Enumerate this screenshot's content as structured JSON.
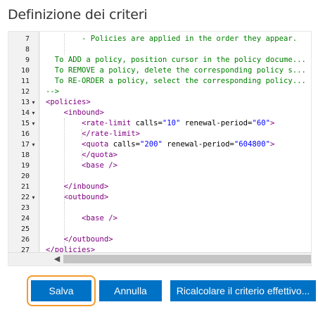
{
  "page": {
    "title": "Definizione dei criteri"
  },
  "editor": {
    "lines": [
      {
        "n": "7",
        "fold": "",
        "segs": [
          {
            "t": "    - Policies are applied in the order they appear.",
            "c": "comment"
          }
        ],
        "indent": 4
      },
      {
        "n": "8",
        "fold": "",
        "segs": [],
        "indent": 0
      },
      {
        "n": "9",
        "fold": "",
        "segs": [
          {
            "t": "  To ADD a policy, position cursor in the policy docume...",
            "c": "comment"
          }
        ],
        "indent": 0
      },
      {
        "n": "10",
        "fold": "",
        "segs": [
          {
            "t": "  To REMOVE a policy, delete the corresponding policy s...",
            "c": "comment"
          }
        ],
        "indent": 0
      },
      {
        "n": "11",
        "fold": "",
        "segs": [
          {
            "t": "  To RE-ORDER a policy, select the corresponding policy...",
            "c": "comment"
          }
        ],
        "indent": 0
      },
      {
        "n": "12",
        "fold": "",
        "segs": [
          {
            "t": "-->",
            "c": "comment"
          }
        ],
        "indent": 0
      },
      {
        "n": "13",
        "fold": "▾",
        "segs": [
          {
            "t": "<policies>",
            "c": "tag"
          }
        ],
        "indent": 0
      },
      {
        "n": "14",
        "fold": "▾",
        "segs": [
          {
            "t": "    ",
            "c": "text"
          },
          {
            "t": "<inbound>",
            "c": "tag"
          }
        ],
        "indent": 0
      },
      {
        "n": "15",
        "fold": "▾",
        "segs": [
          {
            "t": "        ",
            "c": "text"
          },
          {
            "t": "<rate-limit",
            "c": "tag"
          },
          {
            "t": " calls=",
            "c": "attr"
          },
          {
            "t": "\"10\"",
            "c": "val"
          },
          {
            "t": " renewal-period=",
            "c": "attr"
          },
          {
            "t": "\"60\"",
            "c": "val"
          },
          {
            "t": ">",
            "c": "tag"
          }
        ],
        "indent": 0
      },
      {
        "n": "16",
        "fold": "",
        "segs": [
          {
            "t": "        ",
            "c": "text"
          },
          {
            "t": "</rate-limit>",
            "c": "tag"
          }
        ],
        "indent": 0
      },
      {
        "n": "17",
        "fold": "▾",
        "segs": [
          {
            "t": "        ",
            "c": "text"
          },
          {
            "t": "<quota",
            "c": "tag"
          },
          {
            "t": " calls=",
            "c": "attr"
          },
          {
            "t": "\"200\"",
            "c": "val"
          },
          {
            "t": " renewal-period=",
            "c": "attr"
          },
          {
            "t": "\"604800\"",
            "c": "val"
          },
          {
            "t": ">",
            "c": "tag"
          }
        ],
        "indent": 0
      },
      {
        "n": "18",
        "fold": "",
        "segs": [
          {
            "t": "        ",
            "c": "text"
          },
          {
            "t": "</quota>",
            "c": "tag"
          }
        ],
        "indent": 0
      },
      {
        "n": "19",
        "fold": "",
        "segs": [
          {
            "t": "        ",
            "c": "text"
          },
          {
            "t": "<base />",
            "c": "tag"
          }
        ],
        "indent": 0
      },
      {
        "n": "20",
        "fold": "",
        "segs": [],
        "indent": 0
      },
      {
        "n": "21",
        "fold": "",
        "segs": [
          {
            "t": "    ",
            "c": "text"
          },
          {
            "t": "</inbound>",
            "c": "tag"
          }
        ],
        "indent": 0
      },
      {
        "n": "22",
        "fold": "▾",
        "segs": [
          {
            "t": "    ",
            "c": "text"
          },
          {
            "t": "<outbound>",
            "c": "tag"
          }
        ],
        "indent": 0
      },
      {
        "n": "23",
        "fold": "",
        "segs": [],
        "indent": 0
      },
      {
        "n": "24",
        "fold": "",
        "segs": [
          {
            "t": "        ",
            "c": "text"
          },
          {
            "t": "<base />",
            "c": "tag"
          }
        ],
        "indent": 0
      },
      {
        "n": "25",
        "fold": "",
        "segs": [],
        "indent": 0
      },
      {
        "n": "26",
        "fold": "",
        "segs": [
          {
            "t": "    ",
            "c": "text"
          },
          {
            "t": "</outbound>",
            "c": "tag"
          }
        ],
        "indent": 0
      },
      {
        "n": "27",
        "fold": "",
        "segs": [
          {
            "t": "</policies>",
            "c": "tag"
          }
        ],
        "indent": 0
      }
    ]
  },
  "buttons": {
    "save": "Salva",
    "cancel": "Annulla",
    "recalculate": "Ricalcolare il criterio effettivo..."
  },
  "colors": {
    "button": "#0072c6",
    "focus_ring": "#f39a2b",
    "comment": "#008000",
    "tag": "#800080",
    "value": "#0000ff"
  }
}
